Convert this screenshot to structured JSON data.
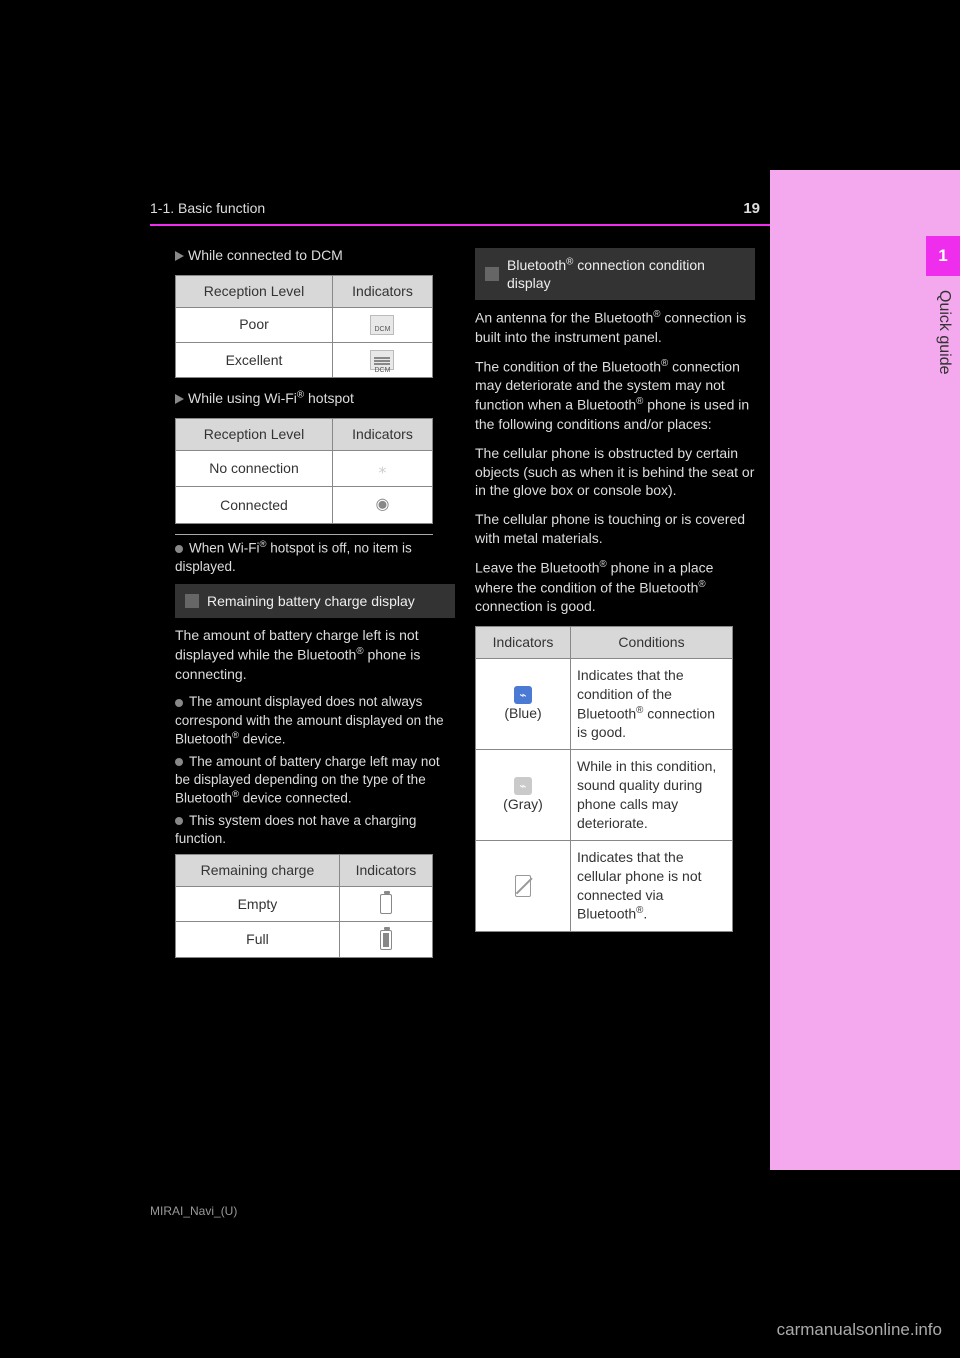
{
  "header": {
    "section_title": "1-1. Basic function",
    "page_number": "19"
  },
  "sidebar": {
    "chapter_number": "1",
    "tab_label": "Quick guide"
  },
  "left": {
    "dcm_caption": "While connected to DCM",
    "wifi_caption": "While using Wi-Fi® hotspot",
    "table_dcm": {
      "head_level": "Reception Level",
      "head_ind": "Indicators",
      "row1": "Poor",
      "row2": "Excellent",
      "icon_label": "DCM"
    },
    "table_wifi": {
      "head_level": "Reception Level",
      "head_ind": "Indicators",
      "row1": "No connection",
      "row2": "Connected"
    },
    "wifi_note": "When Wi-Fi® hotspot is off, no item is displayed.",
    "section_head": "Remaining battery charge display",
    "batt_intro": "The amount of battery charge left is not displayed while the Bluetooth® phone is connecting.",
    "batt_bullets": [
      "The amount displayed does not always correspond with the amount displayed on the Bluetooth® device.",
      "The amount of battery charge left may not be displayed depending on the type of the Bluetooth® device connected.",
      "This system does not have a charging function."
    ],
    "table_batt": {
      "head_level": "Remaining charge",
      "head_ind": "Indicators",
      "row1": "Empty",
      "row2": "Full"
    }
  },
  "right": {
    "section_head": "Bluetooth® connection condition display",
    "bt_para1": "An antenna for the Bluetooth® connection is built into the instrument panel.",
    "bt_para2": "The condition of the Bluetooth® connection may deteriorate and the system may not function when a Bluetooth® phone is used in the following conditions and/or places:",
    "bt_cond1": "The cellular phone is obstructed by certain objects (such as when it is behind the seat or in the glove box or console box).",
    "bt_cond2": "The cellular phone is touching or is covered with metal materials.",
    "bt_para3": "Leave the Bluetooth® phone in a place where the condition of the Bluetooth® connection is good.",
    "table_bt": {
      "head_ind": "Indicators",
      "head_cond": "Conditions",
      "row1_label": "(Blue)",
      "row1_text": "Indicates that the condition of the Bluetooth® connection is good.",
      "row2_label": "(Gray)",
      "row2_text": "While in this condition, sound quality during phone calls may deteriorate.",
      "row3_text": "Indicates that the cellular phone is not connected via Bluetooth®."
    }
  },
  "footer": {
    "impose_line": "MIRAI_Navi_(U)",
    "watermark": "carmanualsonline.info"
  }
}
